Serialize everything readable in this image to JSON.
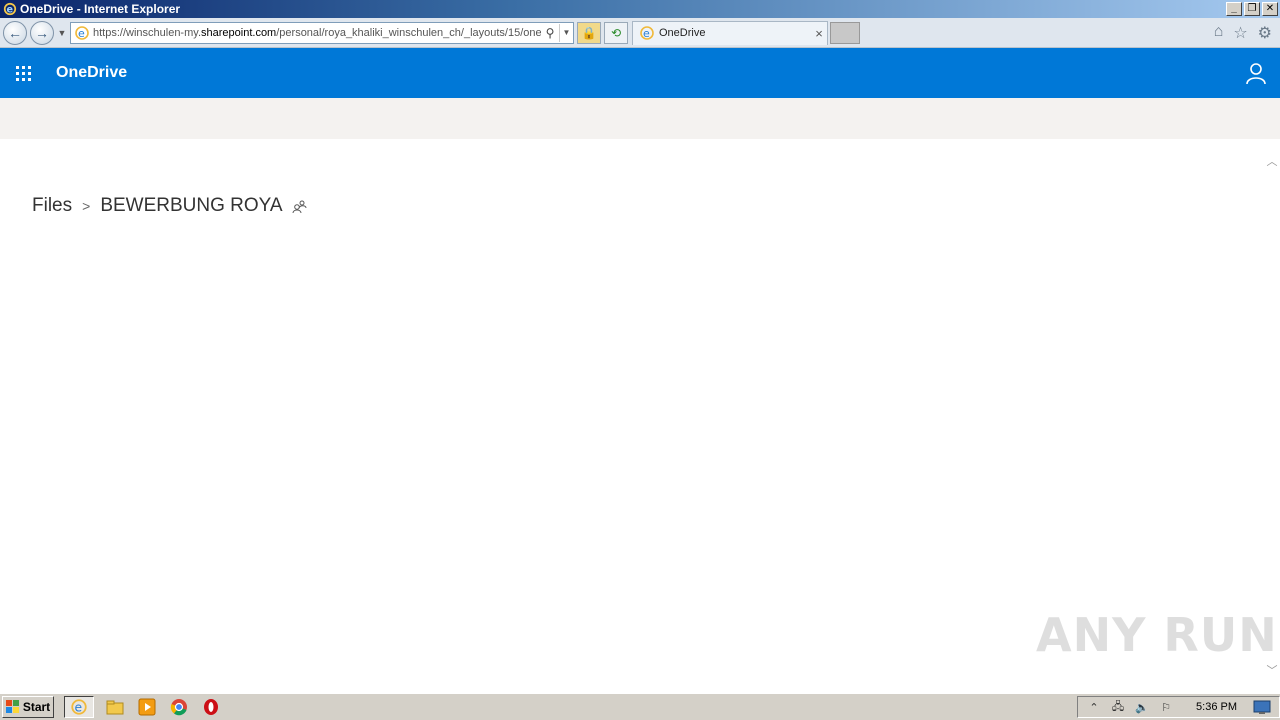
{
  "window": {
    "title": "OneDrive - Internet Explorer"
  },
  "browser": {
    "url_prefix": "https://winschulen-my.",
    "url_domain": "sharepoint.com",
    "url_suffix": "/personal/roya_khaliki_winschulen_ch/_layouts/15/one",
    "tab_label": "OneDrive"
  },
  "suitebar": {
    "brand": "OneDrive",
    "color": "#0078d7"
  },
  "breadcrumb": {
    "root": "Files",
    "current": "BEWERBUNG ROYA"
  },
  "watermark": "ANY RUN",
  "taskbar": {
    "start_label": "Start",
    "clock": "5:36 PM"
  },
  "icons": {
    "back": "back-arrow-icon",
    "forward": "forward-arrow-icon",
    "home": "home-icon",
    "favorites": "star-icon",
    "tools": "gear-icon",
    "app_launcher": "waffle-icon",
    "account": "person-icon",
    "shared": "shared-people-icon"
  }
}
